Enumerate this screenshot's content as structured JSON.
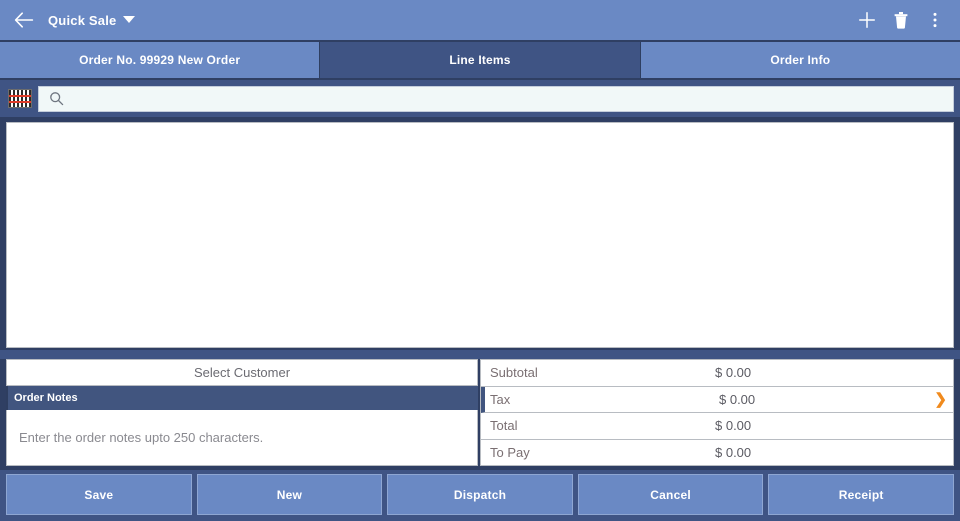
{
  "appbar": {
    "back_icon": "back-arrow-icon",
    "title": "Quick Sale",
    "caret_icon": "chevron-down-icon",
    "actions": [
      {
        "name": "add-button",
        "icon": "plus-icon"
      },
      {
        "name": "delete-button",
        "icon": "trash-icon"
      },
      {
        "name": "overflow-menu-button",
        "icon": "more-vertical-icon"
      }
    ]
  },
  "tabs": [
    {
      "label": "Order No. 99929 New Order",
      "selected": false,
      "name": "tab-order-no"
    },
    {
      "label": "Line Items",
      "selected": true,
      "name": "tab-line-items"
    },
    {
      "label": "Order Info",
      "selected": false,
      "name": "tab-order-info"
    }
  ],
  "search": {
    "barcode_icon": "barcode-scanner-icon",
    "search_icon": "search-icon",
    "value": "",
    "placeholder": ""
  },
  "line_items": {
    "rows": [],
    "empty": true
  },
  "customer": {
    "select_label": "Select Customer"
  },
  "notes": {
    "header": "Order Notes",
    "value": "",
    "placeholder": "Enter the order notes upto 250 characters."
  },
  "totals": [
    {
      "label": "Subtotal",
      "value": "$ 0.00",
      "highlight": false,
      "chevron": false
    },
    {
      "label": "Tax",
      "value": "$ 0.00",
      "highlight": true,
      "chevron": true,
      "chevron_icon": "chevron-right-icon"
    },
    {
      "label": "Total",
      "value": "$ 0.00",
      "highlight": false,
      "chevron": false
    },
    {
      "label": "To Pay",
      "value": "$ 0.00",
      "highlight": false,
      "chevron": false
    }
  ],
  "actions": [
    {
      "label": "Save",
      "name": "save-button"
    },
    {
      "label": "New",
      "name": "new-button"
    },
    {
      "label": "Dispatch",
      "name": "dispatch-button"
    },
    {
      "label": "Cancel",
      "name": "cancel-button"
    },
    {
      "label": "Receipt",
      "name": "receipt-button"
    }
  ],
  "colors": {
    "appbar_blue": "#6a89c4",
    "dark_navy": "#3f5484",
    "notes_header": "#41557f",
    "accent_orange": "#f08a1d",
    "panel_white": "#ffffff"
  }
}
